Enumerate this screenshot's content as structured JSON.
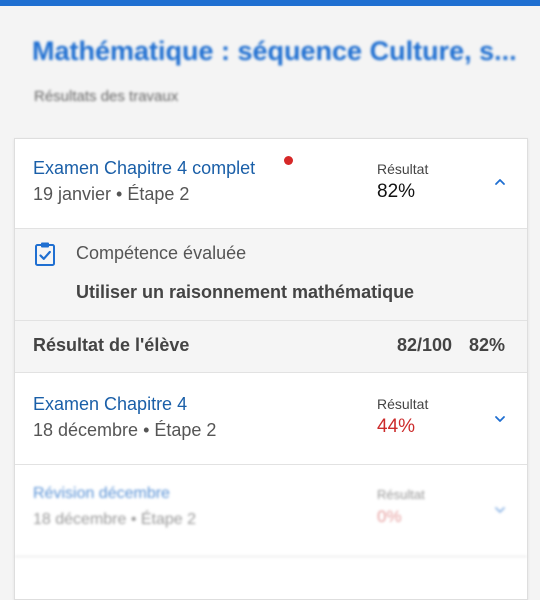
{
  "header": {
    "title": "Mathématique : séquence Culture, s...",
    "subtitle": "Résultats des travaux"
  },
  "colors": {
    "accent": "#1f6fd1",
    "link": "#1a5fa8",
    "alert_red": "#cc2b2b",
    "dot_red": "#d62828"
  },
  "assignments": [
    {
      "title": "Examen Chapitre 4 complet",
      "meta": "19 janvier • Étape 2",
      "result_label": "Résultat",
      "result_value": "82%",
      "state": "expanded",
      "new_indicator": true,
      "icon": "chevron-up-icon"
    },
    {
      "title": "Examen Chapitre 4",
      "meta": "18 décembre • Étape 2",
      "result_label": "Résultat",
      "result_value": "44%",
      "state": "collapsed",
      "icon": "chevron-down-icon"
    },
    {
      "title": "Révision décembre",
      "meta": "18 décembre • Étape 2",
      "result_label": "Résultat",
      "result_value": "0%",
      "state": "collapsed",
      "icon": "chevron-down-icon"
    }
  ],
  "detail": {
    "competency_label": "Compétence évaluée",
    "competency_value": "Utiliser un raisonnement mathématique",
    "competency_icon": "clipboard-check-icon",
    "student_result_label": "Résultat de l'élève",
    "student_score": "82/100",
    "student_percent": "82%"
  }
}
